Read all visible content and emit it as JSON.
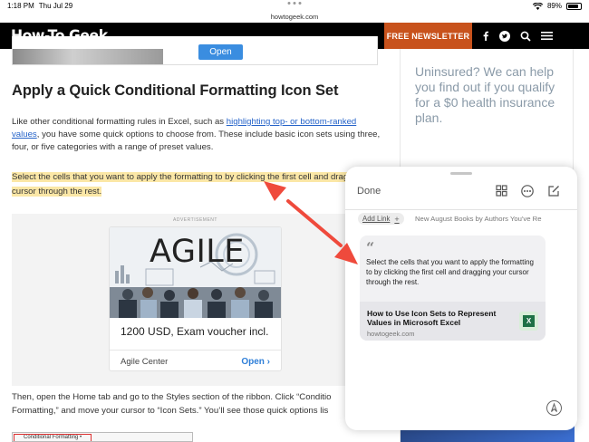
{
  "status": {
    "time": "1:18 PM",
    "date": "Thu Jul 29",
    "battery": "89%",
    "url": "howtogeek.com"
  },
  "header": {
    "logo": "How-To Geek",
    "newsletter": "FREE NEWSLETTER",
    "icons": [
      "facebook-icon",
      "twitter-icon",
      "search-icon",
      "menu-icon"
    ]
  },
  "prev_card": {
    "open_label": "Open"
  },
  "article": {
    "title": "Apply a Quick Conditional Formatting Icon Set",
    "p1_before": "Like other conditional formatting rules in Excel, such as ",
    "p1_link": "highlighting top- or bottom-ranked values",
    "p1_after": ", you have some quick options to choose from. These include basic icon sets using three, four, or five categories with a range of preset values.",
    "highlight": "Select the cells that you want to apply the formatting to by clicking the first cell and dragging your cursor through the rest.",
    "p2_line1": "Then, open the Home tab and go to the Styles section of the ribbon. Click “Conditio",
    "p2_line2": "Formatting,” and move your cursor to “Icon Sets.” You’ll see those quick options lis",
    "thumb_text": "Conditional Formatting •"
  },
  "ad": {
    "label": "ADVERTISEMENT",
    "brand": "AGILE",
    "price": "1200 USD, Exam voucher incl.",
    "advertiser": "Agile Center",
    "open_label": "Open"
  },
  "sidebar": {
    "ad_text": "Uninsured? We can help you find out if you qualify for a $0 health insurance plan."
  },
  "quick_note": {
    "done": "Done",
    "add_link": "Add Link",
    "link_text": "New August Books by Authors You've Re",
    "quote_mark": "“",
    "quote": "Select the cells that you want to apply the formatting to by clicking the first cell and dragging your cursor through the rest.",
    "link_title": "How to Use Icon Sets to Represent Values in Microsoft Excel",
    "link_domain": "howtogeek.com",
    "excel_badge": "X"
  },
  "colors": {
    "accent_orange": "#c8521c",
    "link_blue": "#2563c9",
    "highlight": "#fbe7a6",
    "arrow_red": "#ef4a3c"
  }
}
